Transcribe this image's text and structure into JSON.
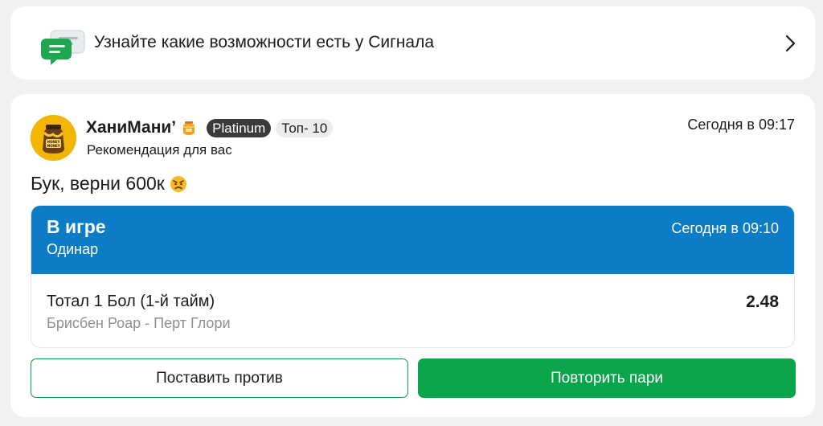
{
  "banner": {
    "text": "Узнайте какие возможности есть у Сигнала",
    "icon": "chat-bubbles-icon"
  },
  "post": {
    "author": "ХаниМани’",
    "badge_tier": "Platinum",
    "badge_rank": "Топ- 10",
    "subtitle": "Рекомендация для вас",
    "time": "Сегодня в 09:17",
    "text": "Бук, верни 600к",
    "avatar_text": "HONEY MONEY"
  },
  "bet": {
    "status": "В игре",
    "type": "Одинар",
    "time": "Сегодня в 09:10",
    "market": "Тотал 1 Бол (1-й тайм)",
    "teams": "Брисбен Роар - Перт Глори",
    "odds": "2.48"
  },
  "actions": {
    "against_label": "Поставить против",
    "repeat_label": "Повторить пари"
  },
  "colors": {
    "bet_header": "#0d7cc6",
    "primary_green": "#0aa54a",
    "badge_dark": "#3a3a3c"
  }
}
